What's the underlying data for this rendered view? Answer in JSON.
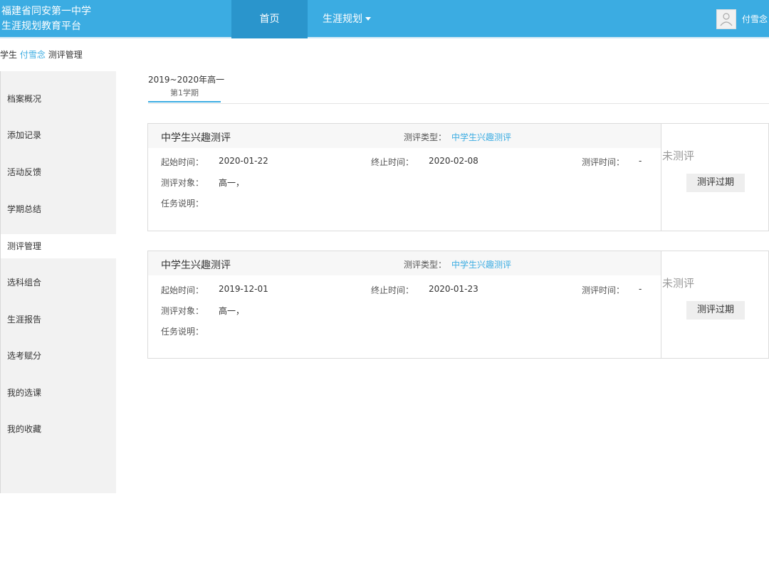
{
  "header": {
    "brand_line1": "福建省同安第一中学",
    "brand_line2": "生涯规划教育平台",
    "nav": {
      "home": "首页",
      "plan": "生涯规划"
    },
    "user_name": "付雪念",
    "accent_color": "#3bace2"
  },
  "breadcrumb": {
    "role": "学生",
    "name": "付雪念",
    "page": "测评管理"
  },
  "sidebar": {
    "items": [
      {
        "label": "档案概况"
      },
      {
        "label": "添加记录"
      },
      {
        "label": "活动反馈"
      },
      {
        "label": "学期总结"
      },
      {
        "label": "测评管理",
        "active": true
      },
      {
        "label": "选科组合"
      },
      {
        "label": "生涯报告"
      },
      {
        "label": "选考赋分"
      },
      {
        "label": "我的选课"
      },
      {
        "label": "我的收藏"
      }
    ]
  },
  "term": {
    "year": "2019~2020年高一",
    "tab": "第1学期"
  },
  "labels": {
    "type": "测评类型：",
    "start": "起始时间：",
    "end": "终止时间：",
    "test_time": "测评时间：",
    "target": "测评对象：",
    "desc": "任务说明："
  },
  "cards": [
    {
      "title": "中学生兴趣测评",
      "type": "中学生兴趣测评",
      "start": "2020-01-22",
      "end": "2020-02-08",
      "test_time": "-",
      "target": "高一，",
      "desc": "",
      "status": "未测评",
      "button": "测评过期"
    },
    {
      "title": "中学生兴趣测评",
      "type": "中学生兴趣测评",
      "start": "2019-12-01",
      "end": "2020-01-23",
      "test_time": "-",
      "target": "高一，",
      "desc": "",
      "status": "未测评",
      "button": "测评过期"
    }
  ]
}
